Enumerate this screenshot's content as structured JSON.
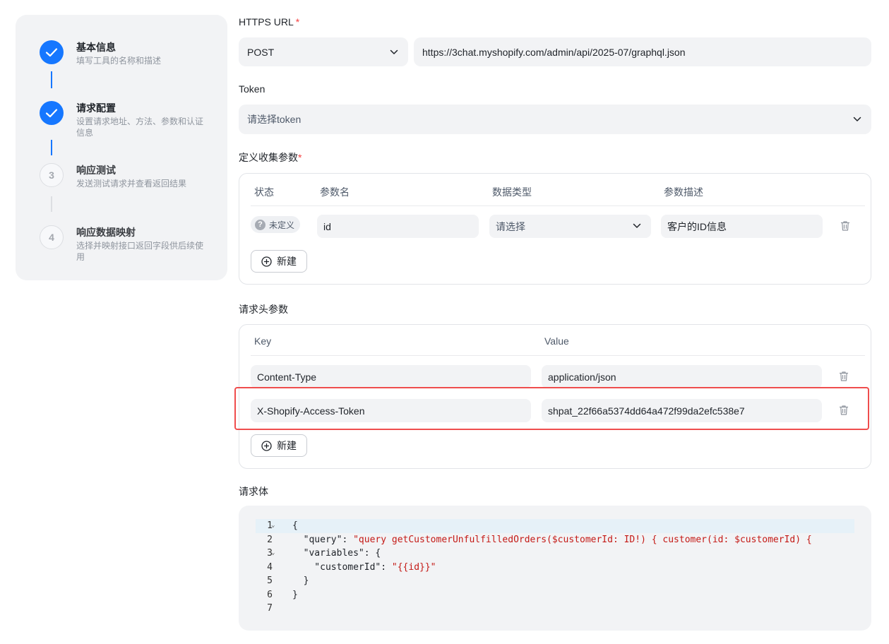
{
  "steps": [
    {
      "index": "1",
      "title": "基本信息",
      "desc": "填写工具的名称和描述",
      "status": "done"
    },
    {
      "index": "2",
      "title": "请求配置",
      "desc": "设置请求地址、方法、参数和认证信息",
      "status": "done"
    },
    {
      "index": "3",
      "title": "响应测试",
      "desc": "发送测试请求并查看返回结果",
      "status": "todo"
    },
    {
      "index": "4",
      "title": "响应数据映射",
      "desc": "选择并映射接口返回字段供后续使用",
      "status": "todo"
    }
  ],
  "url_section": {
    "label": "HTTPS URL",
    "required_mark": "*",
    "method": "POST",
    "url": "https://3chat.myshopify.com/admin/api/2025-07/graphql.json"
  },
  "token_section": {
    "label": "Token",
    "placeholder": "请选择token"
  },
  "params_section": {
    "label": "定义收集参数",
    "required_mark": "*",
    "headers": [
      "状态",
      "参数名",
      "数据类型",
      "参数描述"
    ],
    "rows": [
      {
        "status": "未定义",
        "name": "id",
        "type_placeholder": "请选择",
        "description": "客户的ID信息"
      }
    ],
    "add_label": "新建"
  },
  "headers_section": {
    "label": "请求头参数",
    "headers": [
      "Key",
      "Value"
    ],
    "rows": [
      {
        "key": "Content-Type",
        "value": "application/json"
      },
      {
        "key": "X-Shopify-Access-Token",
        "value": "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"
      }
    ],
    "add_label": "新建"
  },
  "body_section": {
    "label": "请求体",
    "lines": [
      {
        "n": "1",
        "fold": true,
        "parts": [
          [
            "p",
            "{"
          ]
        ]
      },
      {
        "n": "2",
        "fold": false,
        "parts": [
          [
            "p",
            "  \"query\": "
          ],
          [
            "s",
            "\"query getCustomerUnfulfilledOrders($customerId: ID!) { customer(id: $customerId) {"
          ]
        ]
      },
      {
        "n": "3",
        "fold": true,
        "parts": [
          [
            "p",
            "  \"variables\": {"
          ]
        ]
      },
      {
        "n": "4",
        "fold": false,
        "parts": [
          [
            "p",
            "    \"customerId\": "
          ],
          [
            "s",
            "\"{{id}}\""
          ]
        ]
      },
      {
        "n": "5",
        "fold": false,
        "parts": [
          [
            "p",
            "  }"
          ]
        ]
      },
      {
        "n": "6",
        "fold": false,
        "parts": [
          [
            "p",
            "}"
          ]
        ]
      },
      {
        "n": "7",
        "fold": false,
        "parts": [
          [
            "p",
            ""
          ]
        ]
      }
    ]
  },
  "colors": {
    "accent": "#1677ff",
    "required": "#f53f3f",
    "highlight": "#ef4d4d",
    "string": "#c41a16"
  }
}
